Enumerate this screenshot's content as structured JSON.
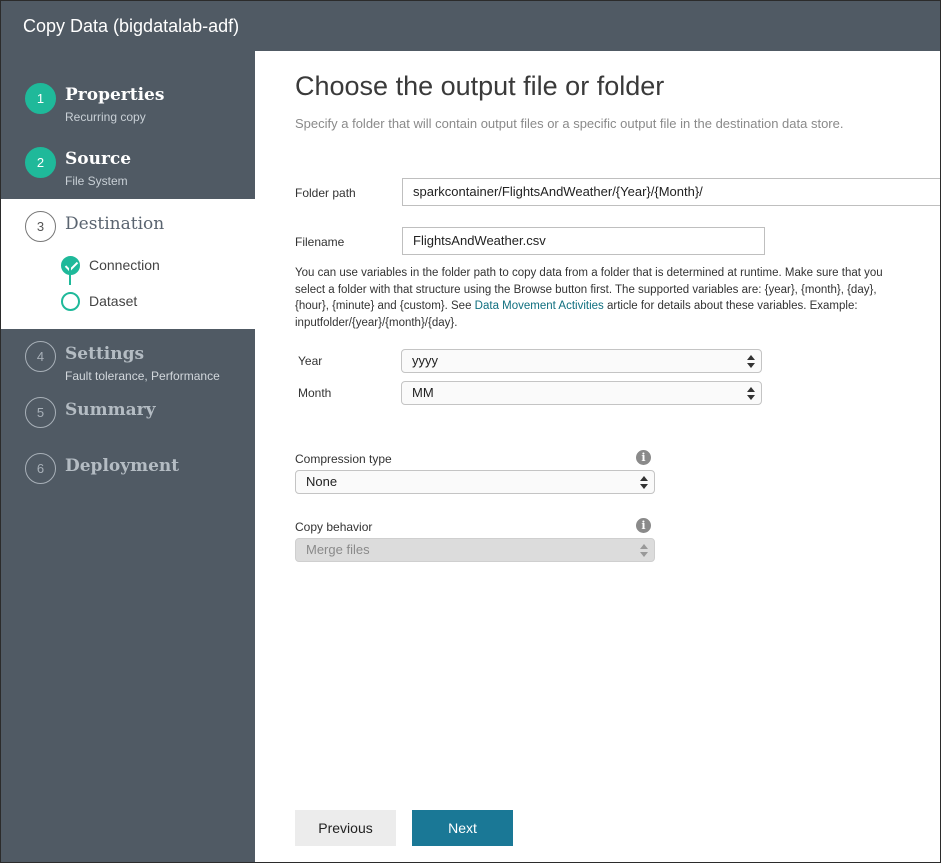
{
  "window": {
    "title": "Copy Data (bigdatalab-adf)"
  },
  "steps": [
    {
      "number": "1",
      "title": "Properties",
      "subtitle": "Recurring copy"
    },
    {
      "number": "2",
      "title": "Source",
      "subtitle": "File System"
    },
    {
      "number": "3",
      "title": "Destination",
      "subtitle": ""
    },
    {
      "number": "4",
      "title": "Settings",
      "subtitle": "Fault tolerance, Performance"
    },
    {
      "number": "5",
      "title": "Summary",
      "subtitle": ""
    },
    {
      "number": "6",
      "title": "Deployment",
      "subtitle": ""
    }
  ],
  "substeps": [
    {
      "label": "Connection",
      "state": "checked"
    },
    {
      "label": "Dataset",
      "state": "current"
    }
  ],
  "main": {
    "heading": "Choose the output file or folder",
    "subheading": "Specify a folder that will contain output files or a specific output file in the destination data store.",
    "folder_path": {
      "label": "Folder path",
      "value": "sparkcontainer/FlightsAndWeather/{Year}/{Month}/"
    },
    "filename": {
      "label": "Filename",
      "value": "FlightsAndWeather.csv"
    },
    "help": {
      "text_before": "You can use variables in the folder path to copy data from a folder that is determined at runtime. Make sure that you select a folder with that structure using the Browse button first. The supported variables are: {year}, {month}, {day}, {hour}, {minute} and {custom}. See ",
      "link": "Data Movement Activities",
      "text_after": " article for details about these variables. Example: inputfolder/{year}/{month}/{day}."
    },
    "year": {
      "label": "Year",
      "value": "yyyy"
    },
    "month": {
      "label": "Month",
      "value": "MM"
    },
    "compression": {
      "label": "Compression type",
      "value": "None"
    },
    "copy_behavior": {
      "label": "Copy behavior",
      "value": "Merge files"
    },
    "info_glyph": "i"
  },
  "buttons": {
    "previous": "Previous",
    "next": "Next"
  },
  "colors": {
    "sidebar": "#505a64",
    "done": "#1fb99a",
    "primary_button": "#1a7896",
    "link": "#0f6f7f"
  },
  "icons": {
    "info": "info-icon",
    "check": "check-icon"
  }
}
